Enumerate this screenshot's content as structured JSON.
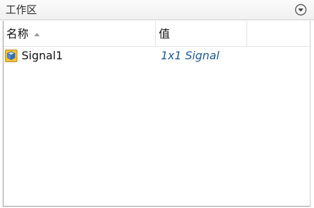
{
  "panel": {
    "title": "工作区",
    "menu_icon": "chevron-down-circle-icon"
  },
  "table": {
    "columns": [
      {
        "label": "名称",
        "sort": "ascending"
      },
      {
        "label": "值"
      },
      {
        "label": ""
      }
    ],
    "rows": [
      {
        "icon": "cube-object-icon",
        "name": "Signal1",
        "value": "1x1 Signal"
      }
    ]
  },
  "colors": {
    "value_text": "#1f5a96",
    "icon_yellow": "#f3c33b",
    "icon_blue": "#4a90d9"
  }
}
